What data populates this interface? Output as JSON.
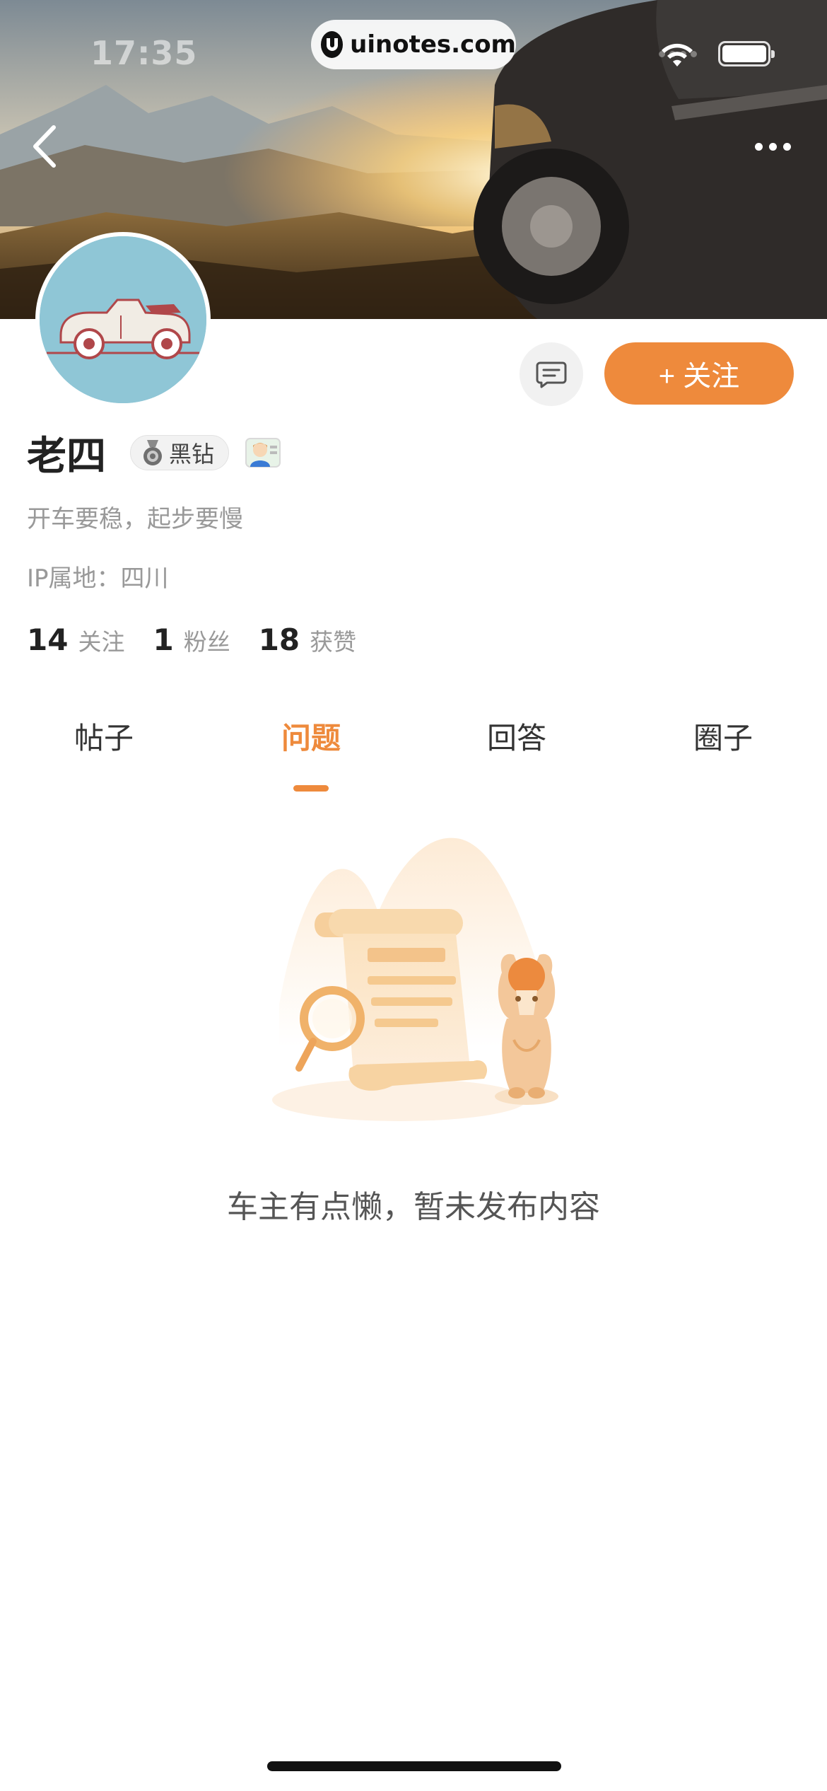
{
  "status_bar": {
    "time": "17:35",
    "watermark": "uinotes.com"
  },
  "cover": {
    "back_icon": "chevron-left-icon",
    "more_icon": "more-dots-icon"
  },
  "profile": {
    "name": "老四",
    "badge_label": "黑钻",
    "bio": "开车要稳，起步要慢",
    "ip_location": "IP属地：四川",
    "follow_button": "+ 关注",
    "message_icon": "message-icon",
    "stats": [
      {
        "value": "14",
        "label": "关注"
      },
      {
        "value": "1",
        "label": "粉丝"
      },
      {
        "value": "18",
        "label": "获赞"
      }
    ]
  },
  "tabs": [
    {
      "label": "帖子",
      "active": false
    },
    {
      "label": "问题",
      "active": true
    },
    {
      "label": "回答",
      "active": false
    },
    {
      "label": "圈子",
      "active": false
    }
  ],
  "empty_state": {
    "message": "车主有点懒，暂未发布内容"
  },
  "colors": {
    "accent": "#ee8a3c",
    "text_primary": "#222222",
    "text_secondary": "#999999"
  }
}
